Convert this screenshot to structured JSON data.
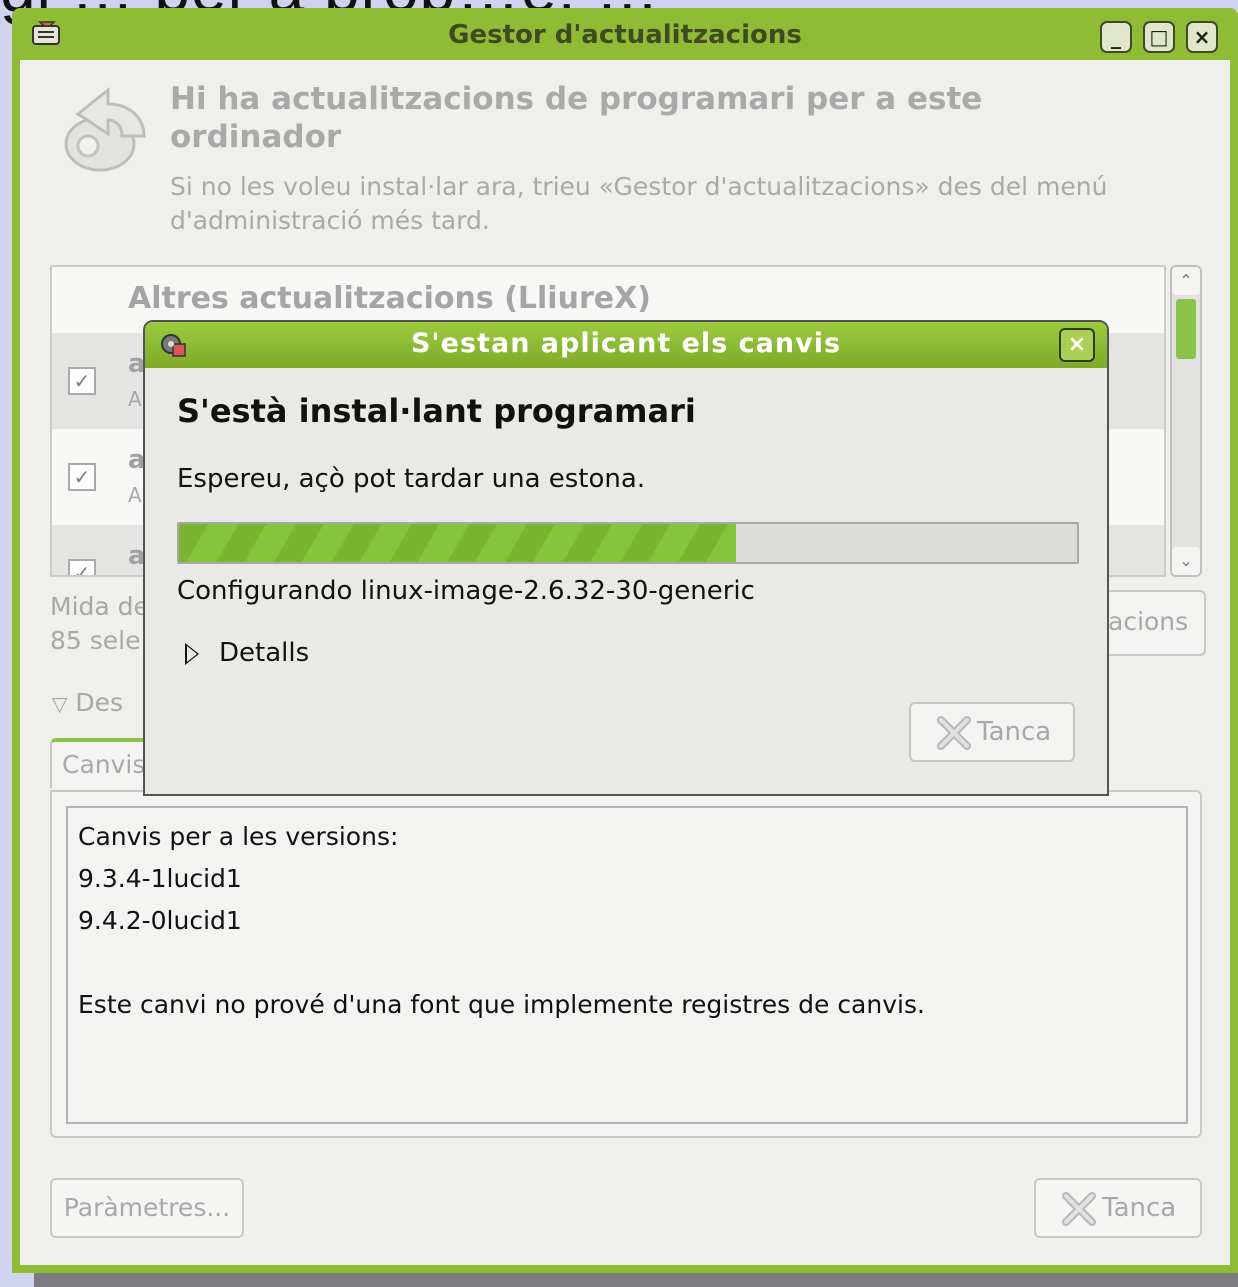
{
  "background_text": "gi … per a prop…e, …",
  "main_window": {
    "title": "Gestor d'actualitzacions",
    "controls": {
      "minimize": "_",
      "maximize": "□",
      "close": "×"
    },
    "header_title": "Hi ha actualitzacions de programari per a este ordinador",
    "header_subtitle": "Si no les voleu instal·lar ara, trieu «Gestor d'actualitzacions» des del menú d'administració més tard.",
    "list_section": "Altres actualitzacions (LliureX)",
    "rows": [
      {
        "name": "a",
        "desc": "A",
        "checked": "✓"
      },
      {
        "name": "a",
        "desc": "A",
        "checked": "✓"
      },
      {
        "name": "a",
        "desc": "",
        "checked": "✓"
      }
    ],
    "scroll_up": "⌃",
    "scroll_down": "⌄",
    "mida_line1": "Mida de",
    "mida_line2": "85 sele",
    "update_button_partial": "acions",
    "description_expander": "Des",
    "tab_label": "Canvis",
    "changes_text": {
      "line1": "Canvis per a les versions:",
      "line2": "9.3.4-1lucid1",
      "line3": "9.4.2-0lucid1",
      "line4": "",
      "line5": "Este canvi no prové d'una font que implemente registres de canvis."
    },
    "settings_button": "Paràmetres...",
    "close_button": "Tanca"
  },
  "dialog": {
    "title": "S'estan aplicant els canvis",
    "close": "×",
    "heading": "S'està instal·lant programari",
    "message": "Espereu, açò pot tardar una estona.",
    "progress_fraction": 0.62,
    "status": "Configurando linux-image-2.6.32-30-generic",
    "details_label": "Detalls",
    "close_button": "Tanca"
  },
  "colors": {
    "titlebar": "#8fbc34",
    "progress": "#86c43c"
  }
}
